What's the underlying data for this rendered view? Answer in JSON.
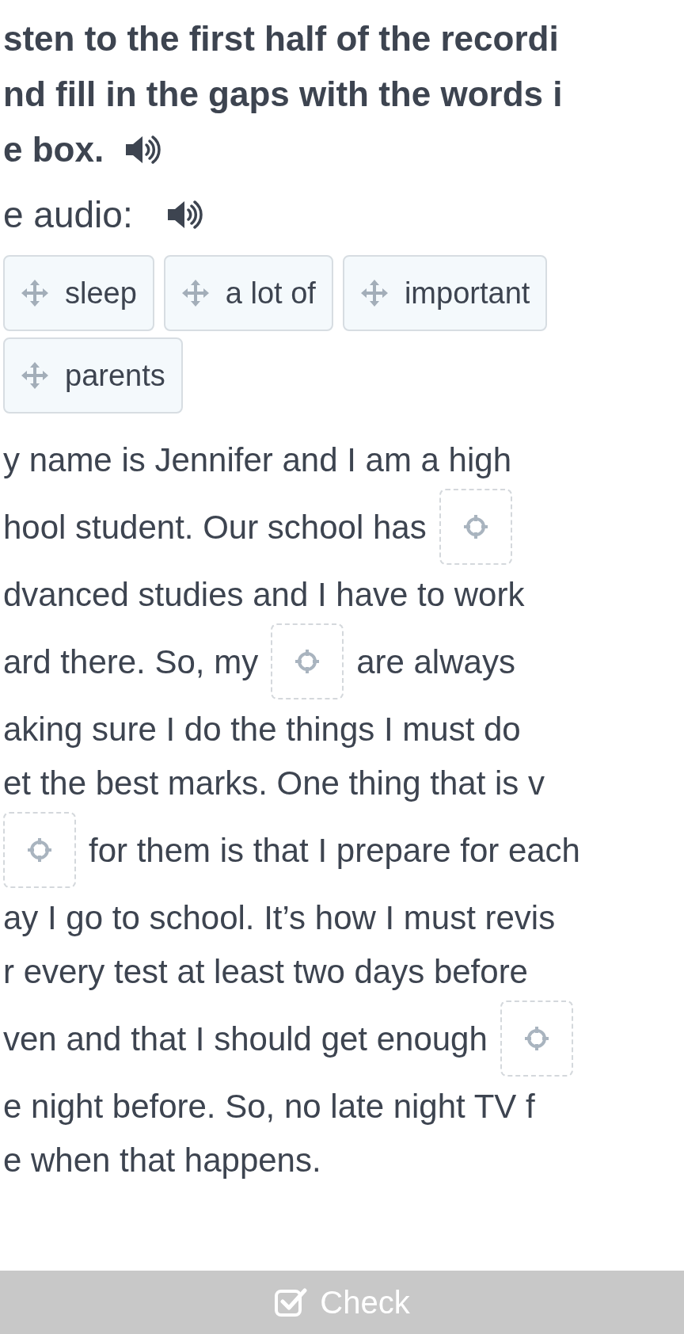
{
  "instruction": {
    "lines": [
      "sten to the first half of the recordi",
      "nd fill in the gaps with the words i",
      "e box."
    ]
  },
  "audio": {
    "label": "e audio:"
  },
  "word_bank": [
    {
      "word": "sleep"
    },
    {
      "word": "a lot of"
    },
    {
      "word": "important"
    },
    {
      "word": "parents"
    }
  ],
  "passage": [
    [
      {
        "kind": "text",
        "text": "y name is Jennifer and I am a high"
      }
    ],
    [
      {
        "kind": "text",
        "text": "hool student. Our school has"
      },
      {
        "kind": "gap"
      }
    ],
    [
      {
        "kind": "text",
        "text": "dvanced studies and I have to work"
      }
    ],
    [
      {
        "kind": "text",
        "text": "ard there. So, my"
      },
      {
        "kind": "gap"
      },
      {
        "kind": "text",
        "text": "are always"
      }
    ],
    [
      {
        "kind": "text",
        "text": "aking sure I do the things I must do"
      }
    ],
    [
      {
        "kind": "text",
        "text": "et the best marks. One thing that is v"
      }
    ],
    [
      {
        "kind": "gap"
      },
      {
        "kind": "text",
        "text": "for them is that I prepare for each"
      }
    ],
    [
      {
        "kind": "text",
        "text": "ay I go to school. It’s how I must revis"
      }
    ],
    [
      {
        "kind": "text",
        "text": "r every test at least two days before"
      }
    ],
    [
      {
        "kind": "text",
        "text": "ven and that I should get enough"
      },
      {
        "kind": "gap"
      }
    ],
    [
      {
        "kind": "text",
        "text": "e night before. So, no late night TV f"
      }
    ],
    [
      {
        "kind": "text",
        "text": "e when that happens."
      }
    ]
  ],
  "check_button": {
    "label": "Check"
  }
}
